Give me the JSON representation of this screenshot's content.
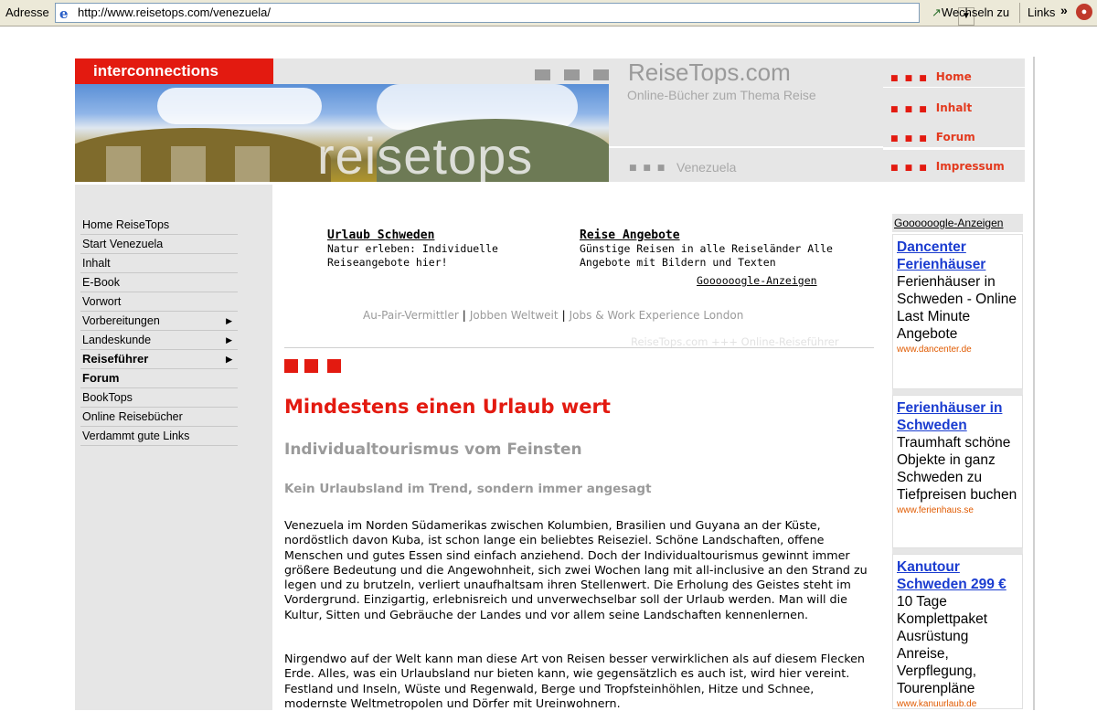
{
  "browser": {
    "address_label": "Adresse",
    "url": "http://www.reisetops.com/venezuela/",
    "go_label": "Wechseln zu",
    "links_label": "Links",
    "links_chevron": "»"
  },
  "header": {
    "brand": "interconnections",
    "site_title": "ReiseTops.com",
    "subtitle": "Online-Bücher zum Thema Reise",
    "photo_word": "reisetops",
    "country": "Venezuela",
    "nav": [
      {
        "label": "Home"
      },
      {
        "label": "Inhalt"
      },
      {
        "label": "Forum"
      },
      {
        "label": "Impressum"
      }
    ],
    "square_marker": "■ ■ ■"
  },
  "sidebar": {
    "items": [
      {
        "label": "Home ReiseTops",
        "bold": false,
        "arrow": false
      },
      {
        "label": "Start Venezuela",
        "bold": false,
        "arrow": false
      },
      {
        "label": "Inhalt",
        "bold": false,
        "arrow": false
      },
      {
        "label": "E-Book",
        "bold": false,
        "arrow": false
      },
      {
        "label": "Vorwort",
        "bold": false,
        "arrow": false
      },
      {
        "label": "Vorbereitungen",
        "bold": false,
        "arrow": true
      },
      {
        "label": "Landeskunde",
        "bold": false,
        "arrow": true
      },
      {
        "label": "Reiseführer",
        "bold": true,
        "arrow": true
      },
      {
        "label": "Forum",
        "bold": true,
        "arrow": false
      },
      {
        "label": "BookTops",
        "bold": false,
        "arrow": false
      },
      {
        "label": "Online Reisebücher",
        "bold": false,
        "arrow": false
      },
      {
        "label": "Verdammt gute Links",
        "bold": false,
        "arrow": false
      }
    ],
    "arrow_glyph": "▶"
  },
  "top_ads": {
    "ad1": {
      "title": "Urlaub Schweden",
      "text": "Natur erleben: Individuelle Reiseangebote hier!"
    },
    "ad2": {
      "title": "Reise Angebote",
      "text": "Günstige Reisen in alle Reiseländer Alle Angebote mit Bildern und Texten"
    },
    "google_label": "Goooooogle-Anzeigen"
  },
  "links_row": {
    "items": [
      "Au-Pair-Vermittler",
      "Jobben Weltweit",
      "Jobs & Work Experience London"
    ],
    "separator": "|"
  },
  "ticker": "ReiseTops.com +++ Online-Reiseführer",
  "article": {
    "h1": "Mindestens einen Urlaub wert",
    "h2": "Individualtourismus vom Feinsten",
    "h3": "Kein Urlaubsland im Trend, sondern immer angesagt",
    "p1": "Venezuela im Norden Südamerikas zwischen Kolumbien, Brasilien und Guyana an der Küste, nordöstlich davon Kuba, ist schon lange ein beliebtes Reiseziel. Schöne Landschaften, offene Menschen und gutes Essen sind einfach anziehend. Doch der Individualtourismus gewinnt immer größere Bedeutung und die Angewohnheit, sich zwei Wochen lang mit all-inclusive an den Strand zu legen und zu brutzeln, verliert unaufhaltsam ihren Stellenwert. Die Erholung des Geistes steht im Vordergrund. Einzigartig, erlebnisreich und unverwechselbar soll der Urlaub werden. Man will die Kultur, Sitten und Gebräuche der Landes und vor allem seine Landschaften kennenlernen.",
    "p2": "Nirgendwo auf der Welt kann man diese Art von Reisen besser verwirklichen als auf diesem Flecken Erde. Alles, was ein Urlaubsland nur bieten kann, wie gegensätzlich es auch ist, wird hier vereint. Festland und Inseln, Wüste und Regenwald, Berge und Tropfsteinhöhlen, Hitze und Schnee, modernste Weltmetropolen und Dörfer mit Ureinwohnern."
  },
  "right_ads": {
    "label": "Goooooogle-Anzeigen",
    "ads": [
      {
        "title": "Dancenter Ferienhäuser",
        "text": "Ferienhäuser in Schweden - Online Last Minute Angebote",
        "url": "www.dancenter.de"
      },
      {
        "title": "Ferienhäuser in Schweden",
        "text": "Traumhaft schöne Objekte in ganz Schweden zu Tiefpreisen buchen",
        "url": "www.ferienhaus.se"
      },
      {
        "title": "Kanutour Schweden 299 €",
        "text": "10 Tage Komplettpaket Ausrüstung Anreise, Verpflegung, Tourenpläne",
        "url": "www.kanuurlaub.de"
      }
    ]
  },
  "colors": {
    "accent_red": "#e31a10",
    "nav_red": "#e33a1e",
    "grey_panel": "#e6e6e6",
    "ad_link_blue": "#1a3cd0"
  }
}
